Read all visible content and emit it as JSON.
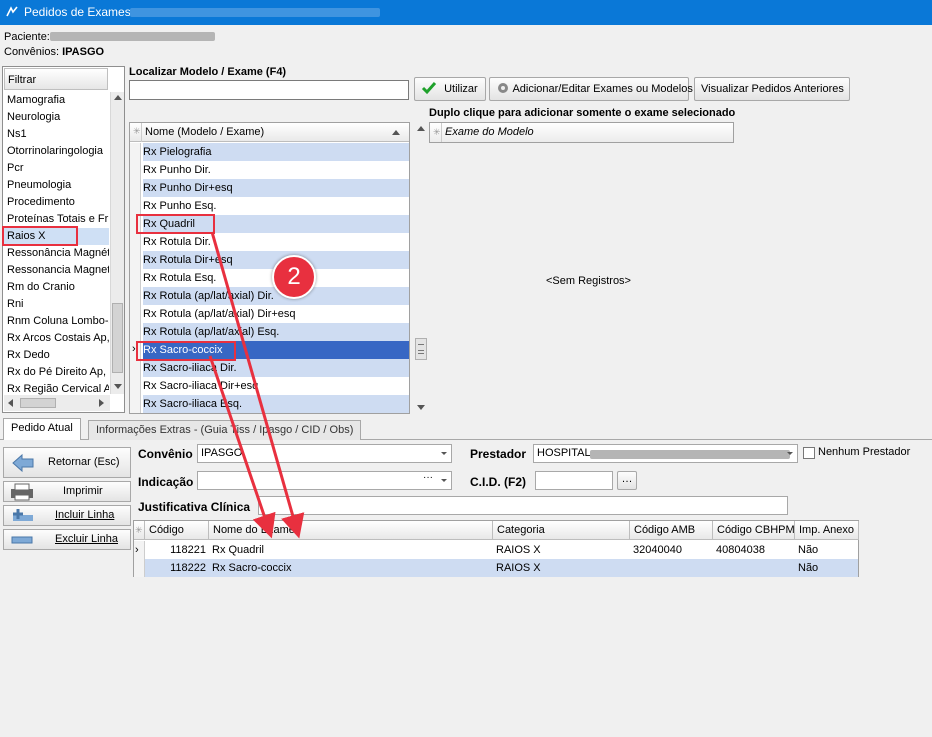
{
  "window": {
    "title": "Pedidos de Exames"
  },
  "patient": {
    "label": "Paciente:",
    "convenios_label": "Convênios:",
    "convenios_value": "IPASGO"
  },
  "filter": {
    "header": "Filtrar",
    "items": [
      "Mamografia",
      "Neurologia",
      "Ns1",
      "Otorrinolaringologia",
      "Pcr",
      "Pneumologia",
      "Procedimento",
      "Proteínas Totais e Fr",
      "Raios X",
      "Ressonância Magnéti",
      "Ressonancia Magneti",
      "Rm do Cranio",
      "Rni",
      "Rnm Coluna Lombo-s",
      "Rx Arcos Costais Ap,",
      "Rx Dedo",
      "Rx do Pé Direito Ap,",
      "Rx Região Cervical A"
    ]
  },
  "search": {
    "label": "Localizar Modelo / Exame (F4)",
    "value": ""
  },
  "toolbar": {
    "utilizar": "Utilizar",
    "adicionar": "Adicionar/Editar Exames ou Modelos",
    "visualizar": "Visualizar Pedidos Anteriores"
  },
  "exam_grid": {
    "header": "Nome (Modelo / Exame)",
    "rows": [
      "Rx Pielografia",
      "Rx Punho Dir.",
      "Rx Punho Dir+esq",
      "Rx Punho Esq.",
      "Rx Quadril",
      "Rx Rotula  Dir.",
      "Rx Rotula  Dir+esq",
      "Rx Rotula  Esq.",
      "Rx Rotula (ap/lat/axial) Dir.",
      "Rx Rotula (ap/lat/axial) Dir+esq",
      "Rx Rotula (ap/lat/axial) Esq.",
      "Rx Sacro-coccix",
      "Rx Sacro-iliaca Dir.",
      "Rx Sacro-iliaca Dir+esq",
      "Rx Sacro-iliaca Esq."
    ]
  },
  "right_panel": {
    "label": "Duplo clique para adicionar somente o exame selecionado",
    "header": "Exame do Modelo",
    "empty": "<Sem Registros>"
  },
  "annotation": {
    "step": "2"
  },
  "tabs": [
    "Pedido Atual",
    "Informações Extras -  (Guia Tiss / Ipasgo / CID / Obs)"
  ],
  "actions": {
    "retornar": "Retornar (Esc)",
    "imprimir": "Imprimir",
    "incluir": "Incluir Linha",
    "excluir": "Excluir Linha"
  },
  "form": {
    "convenio_label": "Convênio",
    "convenio_value": "IPASGO",
    "indicacao_label": "Indicação",
    "indicacao_value": "",
    "prestador_label": "Prestador",
    "prestador_value": "HOSPITAL",
    "nenhum_prestador": "Nenhum Prestador",
    "cid_label": "C.I.D. (F2)",
    "cid_value": "",
    "justificativa_label": "Justificativa Clínica",
    "justificativa_value": ""
  },
  "order_grid": {
    "columns": [
      "Código",
      "Nome do Exame",
      "Categoria",
      "Código AMB",
      "Código CBHPM",
      "Imp. Anexo"
    ],
    "rows": [
      {
        "codigo": "118221",
        "nome": "Rx Quadril",
        "categoria": "RAIOS X",
        "amb": "32040040",
        "cbhpm": "40804038",
        "anexo": "Não"
      },
      {
        "codigo": "118222",
        "nome": "Rx Sacro-coccix",
        "categoria": "RAIOS X",
        "amb": "",
        "cbhpm": "",
        "anexo": "Não"
      }
    ]
  },
  "colors": {
    "titlebar": "#0a78d7",
    "selection": "#3767c4",
    "alt_row": "#cedcf2",
    "annotation": "#e8303f"
  }
}
